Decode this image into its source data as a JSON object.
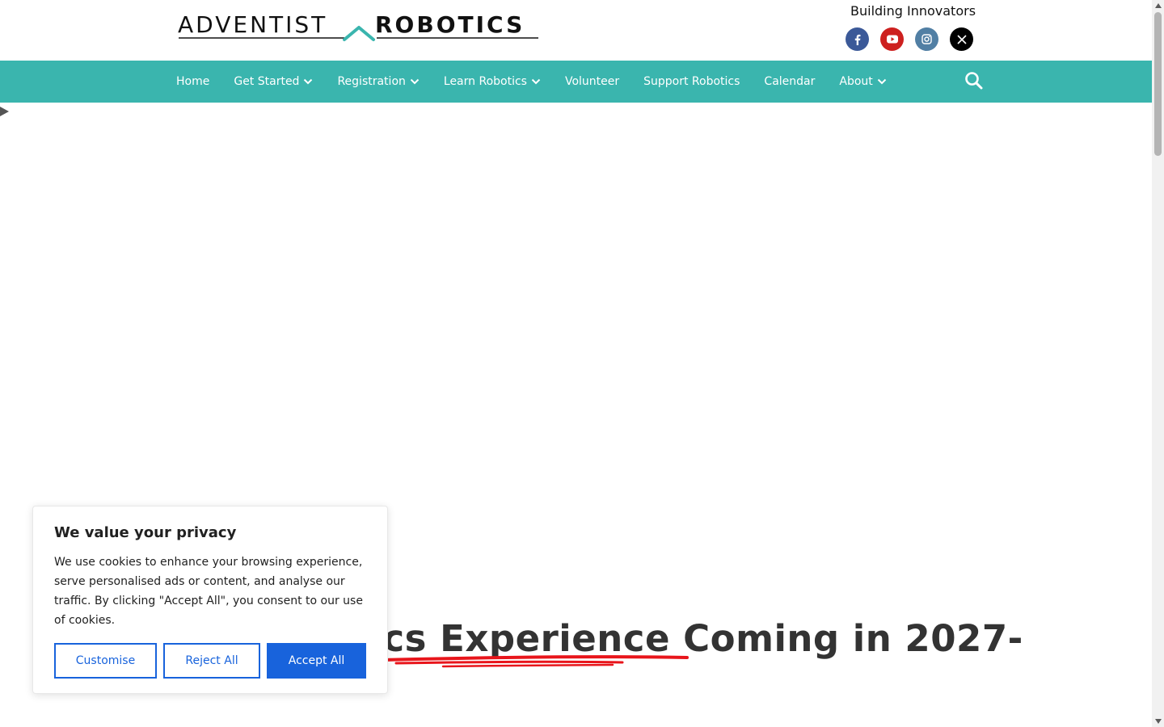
{
  "header": {
    "logo_text_left": "ADVENTIST",
    "logo_text_right": "ROBOTICS",
    "tagline": "Building Innovators",
    "socials": [
      {
        "name": "facebook",
        "icon": "facebook-icon",
        "color": "#3b5998"
      },
      {
        "name": "youtube",
        "icon": "youtube-icon",
        "color": "#cd201f"
      },
      {
        "name": "instagram",
        "icon": "instagram-icon",
        "color": "#517fa4"
      },
      {
        "name": "x",
        "icon": "x-icon",
        "color": "#000000"
      }
    ]
  },
  "nav": {
    "items": [
      {
        "label": "Home",
        "dropdown": false
      },
      {
        "label": "Get Started",
        "dropdown": true
      },
      {
        "label": "Registration",
        "dropdown": true
      },
      {
        "label": "Learn Robotics",
        "dropdown": true
      },
      {
        "label": "Volunteer",
        "dropdown": false
      },
      {
        "label": "Support Robotics",
        "dropdown": false
      },
      {
        "label": "Calendar",
        "dropdown": false
      },
      {
        "label": "About",
        "dropdown": true
      }
    ],
    "search_icon": "search-icon",
    "background": "#3ab5ae"
  },
  "hero": {
    "title": "obotics Experience Coming in 2027-",
    "underline_color": "#e8151b"
  },
  "cookie_banner": {
    "title": "We value your privacy",
    "text": "We use cookies to enhance your browsing experience, serve personalised ads or content, and analyse our traffic. By clicking \"Accept All\", you consent to our use of cookies.",
    "customise_label": "Customise",
    "reject_label": "Reject All",
    "accept_label": "Accept All",
    "accent": "#1863dc"
  }
}
